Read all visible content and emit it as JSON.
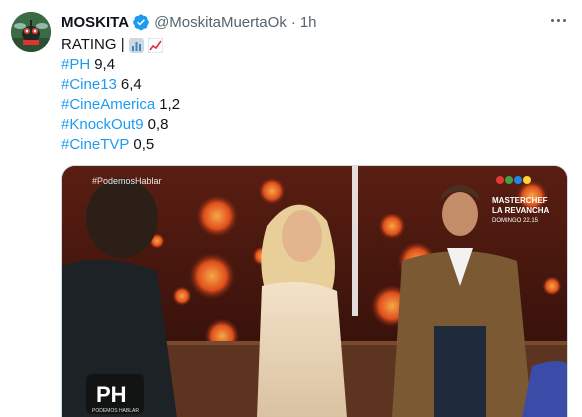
{
  "tweet": {
    "display_name": "MOSKITA",
    "handle": "@MoskitaMuertaOk",
    "separator": "·",
    "time": "1h",
    "verified_icon": "verified-badge-icon",
    "more_icon": "more-options-icon",
    "text_line": "RATING |",
    "emojis": [
      "bar-chart-emoji",
      "chart-increasing-emoji"
    ],
    "ratings": [
      {
        "tag": "#PH",
        "value": "9,4"
      },
      {
        "tag": "#Cine13",
        "value": "6,4"
      },
      {
        "tag": "#CineAmerica",
        "value": "1,2"
      },
      {
        "tag": "#KnockOut9",
        "value": "0,8"
      },
      {
        "tag": "#CineTVP",
        "value": "0,5"
      }
    ],
    "media": {
      "hashtag_overlay": "#PodemosHablar",
      "promo_title_1": "MASTERCHEF",
      "promo_title_2": "LA REVANCHA",
      "promo_time": "DOMINGO 22.15",
      "logo_text": "PH",
      "logo_subtext": "PODEMOS HABLAR"
    }
  },
  "colors": {
    "link": "#1d9bf0",
    "secondary_text": "#536471",
    "verified": "#1d9bf0"
  }
}
